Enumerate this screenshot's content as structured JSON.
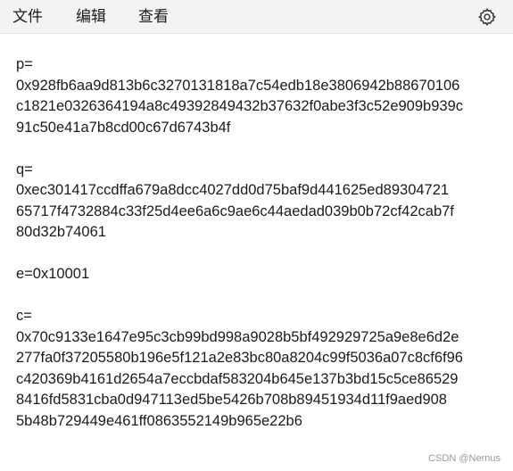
{
  "menubar": {
    "file": "文件",
    "edit": "编辑",
    "view": "查看",
    "settings_icon": "gear-icon"
  },
  "editor": {
    "lines": [
      "p=",
      "0x928fb6aa9d813b6c3270131818a7c54edb18e3806942b88670106",
      "c1821e0326364194a8c49392849432b37632f0abe3f3c52e909b939c",
      "91c50e41a7b8cd00c67d6743b4f",
      "",
      "q=",
      "0xec301417ccdffa679a8dcc4027dd0d75baf9d441625ed89304721",
      "65717f4732884c33f25d4ee6a6c9ae6c44aedad039b0b72cf42cab7f",
      "80d32b74061",
      "",
      "e=0x10001",
      "",
      "c=",
      "0x70c9133e1647e95c3cb99bd998a9028b5bf492929725a9e8e6d2e",
      "277fa0f37205580b196e5f121a2e83bc80a8204c99f5036a07c8cf6f96",
      "c420369b4161d2654a7eccbdaf583204b645e137b3bd15c5ce86529",
      "8416fd5831cba0d947113ed5be5426b708b89451934d11f9aed908",
      "5b48b729449e461ff0863552149b965e22b6"
    ]
  },
  "watermark": "CSDN @Nernus"
}
